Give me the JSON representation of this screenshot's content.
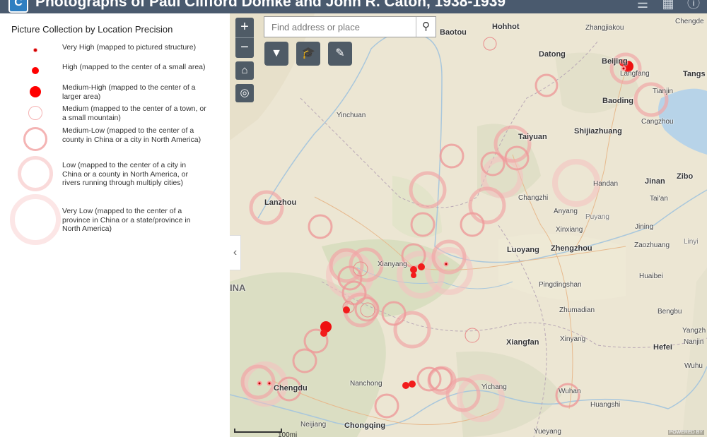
{
  "header": {
    "title": "Photographs of Paul Clifford Domke and John R. Caton, 1938-1939",
    "logo_glyph": "C",
    "icons": [
      "layers-icon",
      "basemap-gallery-icon",
      "info-icon"
    ]
  },
  "legend": {
    "title": "Picture Collection by Location Precision",
    "items": [
      {
        "label": "Very High (mapped to pictured structure)"
      },
      {
        "label": "High (mapped to the center of a small area)"
      },
      {
        "label": "Medium-High (mapped to the center of a larger area)"
      },
      {
        "label": "Medium (mapped to the center of a town, or a small mountain)"
      },
      {
        "label": "Medium-Low (mapped to the center of a county in China or a city in North America)"
      },
      {
        "label": "Low (mapped to the center of a city in China or a county in North America, or rivers running through multiply cities)"
      },
      {
        "label": "Very Low (mapped to the center of a province in China or a state/province in North America)"
      }
    ]
  },
  "search": {
    "placeholder": "Find address or place"
  },
  "map": {
    "cities": [
      {
        "name": "Baotou",
        "big": true
      },
      {
        "name": "Hohhot",
        "big": true
      },
      {
        "name": "Zhangjiakou",
        "big": false
      },
      {
        "name": "Chengde",
        "big": false
      },
      {
        "name": "Datong",
        "big": true
      },
      {
        "name": "Beijing",
        "big": true
      },
      {
        "name": "Langfang",
        "big": false
      },
      {
        "name": "Tangs",
        "big": true
      },
      {
        "name": "Tianjin",
        "big": false
      },
      {
        "name": "Baoding",
        "big": true
      },
      {
        "name": "Yinchuan",
        "big": false
      },
      {
        "name": "Cangzhou",
        "big": false
      },
      {
        "name": "Taiyuan",
        "big": true
      },
      {
        "name": "Shijiazhuang",
        "big": true
      },
      {
        "name": "Handan",
        "big": false
      },
      {
        "name": "Jinan",
        "big": true
      },
      {
        "name": "Zibo",
        "big": true
      },
      {
        "name": "Tai'an",
        "big": false
      },
      {
        "name": "Changzhi",
        "big": false
      },
      {
        "name": "Lanzhou",
        "big": true
      },
      {
        "name": "Anyang",
        "big": false
      },
      {
        "name": "Puyang",
        "big": false
      },
      {
        "name": "Jining",
        "big": false
      },
      {
        "name": "Xinxiang",
        "big": false
      },
      {
        "name": "Luoyang",
        "big": true
      },
      {
        "name": "Zhengzhou",
        "big": true
      },
      {
        "name": "Zaozhuang",
        "big": false
      },
      {
        "name": "Linyi",
        "big": false
      },
      {
        "name": "Xianyang",
        "big": false
      },
      {
        "name": "Huaibei",
        "big": false
      },
      {
        "name": "INA",
        "big": true
      },
      {
        "name": "Pingdingshan",
        "big": false
      },
      {
        "name": "Zhumadian",
        "big": false
      },
      {
        "name": "Bengbu",
        "big": false
      },
      {
        "name": "Xiangfan",
        "big": true
      },
      {
        "name": "Xinyang",
        "big": false
      },
      {
        "name": "Yangzh",
        "big": false
      },
      {
        "name": "Hefei",
        "big": true
      },
      {
        "name": "Nanjin",
        "big": false
      },
      {
        "name": "Chengdu",
        "big": true
      },
      {
        "name": "Nanchong",
        "big": false
      },
      {
        "name": "Yichang",
        "big": false
      },
      {
        "name": "Wuhan",
        "big": false
      },
      {
        "name": "Wuhu",
        "big": false
      },
      {
        "name": "Huangshi",
        "big": false
      },
      {
        "name": "Neijiang",
        "big": false
      },
      {
        "name": "Chongqing",
        "big": true
      },
      {
        "name": "Yueyang",
        "big": false
      }
    ],
    "scale_label": "100mi",
    "attribution": "POWERED BY"
  }
}
